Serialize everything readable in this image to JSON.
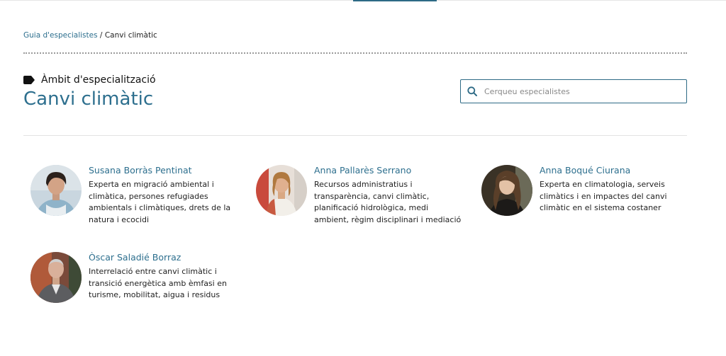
{
  "breadcrumb": {
    "root": "Guia d'especialistes",
    "separator": "/",
    "current": "Canvi climàtic"
  },
  "header": {
    "area_label": "Àmbit d'especialització",
    "title": "Canvi climàtic",
    "tag_icon": "tag-icon"
  },
  "search": {
    "placeholder": "Cerqueu especialistes",
    "value": "",
    "icon": "search-icon"
  },
  "colors": {
    "accent": "#2d6f8e",
    "border": "#2d6a85",
    "text": "#222222"
  },
  "experts": [
    {
      "name": "Susana Borràs Pentinat",
      "description": "Experta en migració ambiental i climàtica, persones refugiades ambientals i climàtiques, drets de la natura i ecocidi"
    },
    {
      "name": "Anna Pallarès Serrano",
      "description": "Recursos administratius i transparència, canvi climàtic, planificació hidrològica, medi ambient, règim disciplinari i mediació"
    },
    {
      "name": "Anna Boqué Ciurana",
      "description": "Experta en climatologia, serveis climàtics i en impactes del canvi climàtic en el sistema costaner"
    },
    {
      "name": "Òscar Saladié Borraz",
      "description": "Interrelació entre canvi climàtic i transició energètica amb èmfasi en turisme, mobilitat, aigua i residus"
    }
  ]
}
